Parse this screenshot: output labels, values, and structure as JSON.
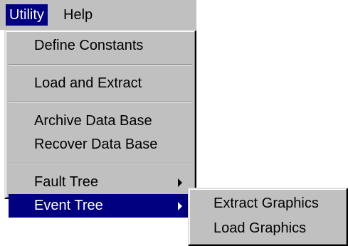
{
  "menubar": {
    "utility_label": "Utility",
    "help_label": "Help"
  },
  "utility_menu": {
    "define_constants": "Define Constants",
    "load_and_extract": "Load and Extract",
    "archive_data_base": "Archive Data Base",
    "recover_data_base": "Recover Data Base",
    "fault_tree": "Fault Tree",
    "event_tree": "Event Tree"
  },
  "event_tree_submenu": {
    "extract_graphics": "Extract Graphics",
    "load_graphics": "Load Graphics"
  },
  "colors": {
    "menu_bg": "#c0c0c0",
    "highlight": "#000080",
    "highlight_text": "#ffffff"
  }
}
